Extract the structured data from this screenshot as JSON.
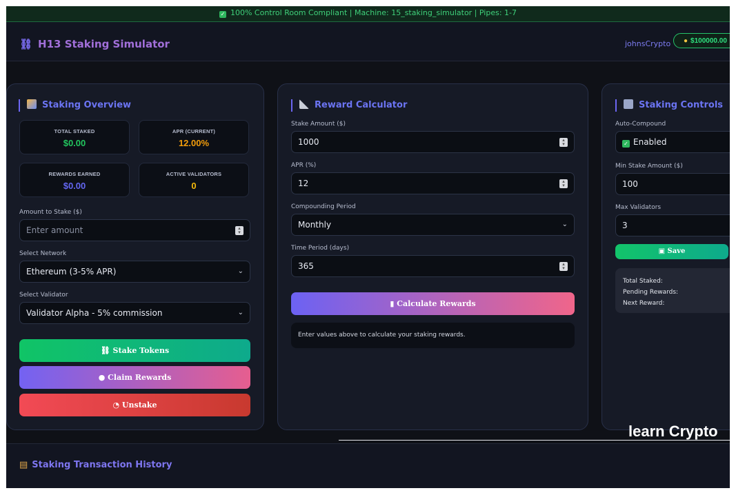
{
  "compliance_bar": {
    "icon": "check-icon",
    "text": "100% Control Room Compliant | Machine: 15_staking_simulator | Pipes: 1-7"
  },
  "header": {
    "logo_icon": "link-chain-icon",
    "title": "H13 Staking Simulator",
    "username": "johnsCrypto",
    "balance_icon": "money-bag-icon",
    "balance": "$100000.00"
  },
  "overview": {
    "icon": "bar-chart-icon",
    "title": "Staking Overview",
    "stats": [
      {
        "label": "TOTAL STAKED",
        "value": "$0.00",
        "color": "#22c55e"
      },
      {
        "label": "APR (CURRENT)",
        "value": "12.00%",
        "color": "#f59e0b"
      },
      {
        "label": "REWARDS EARNED",
        "value": "$0.00",
        "color": "#6366f1"
      },
      {
        "label": "ACTIVE VALIDATORS",
        "value": "0",
        "color": "#f5b90b"
      }
    ],
    "amount_label": "Amount to Stake ($)",
    "amount_placeholder": "Enter amount",
    "network_label": "Select Network",
    "network_value": "Ethereum (3-5% APR)",
    "validator_label": "Select Validator",
    "validator_value": "Validator Alpha - 5% commission",
    "stake_button": "Stake Tokens",
    "claim_button": "Claim Rewards",
    "unstake_button": "Unstake"
  },
  "calculator": {
    "icon": "triangle-ruler-icon",
    "title": "Reward Calculator",
    "stake_label": "Stake Amount ($)",
    "stake_value": "1000",
    "apr_label": "APR (%)",
    "apr_value": "12",
    "period_label": "Compounding Period",
    "period_value": "Monthly",
    "days_label": "Time Period (days)",
    "days_value": "365",
    "calc_button": "Calculate Rewards",
    "result_text": "Enter values above to calculate your staking rewards."
  },
  "controls": {
    "icon": "control-knobs-icon",
    "title": "Staking Controls",
    "autocompound_label": "Auto-Compound",
    "autocompound_value": "Enabled",
    "min_label": "Min Stake Amount ($)",
    "min_value": "100",
    "max_label": "Max Validators",
    "max_value": "3",
    "save_button": "Save",
    "summary": [
      "Total Staked:",
      "Pending Rewards:",
      "Next Reward:"
    ]
  },
  "history": {
    "icon": "scroll-icon",
    "title": "Staking Transaction History"
  },
  "watermark": "learn Crypto"
}
